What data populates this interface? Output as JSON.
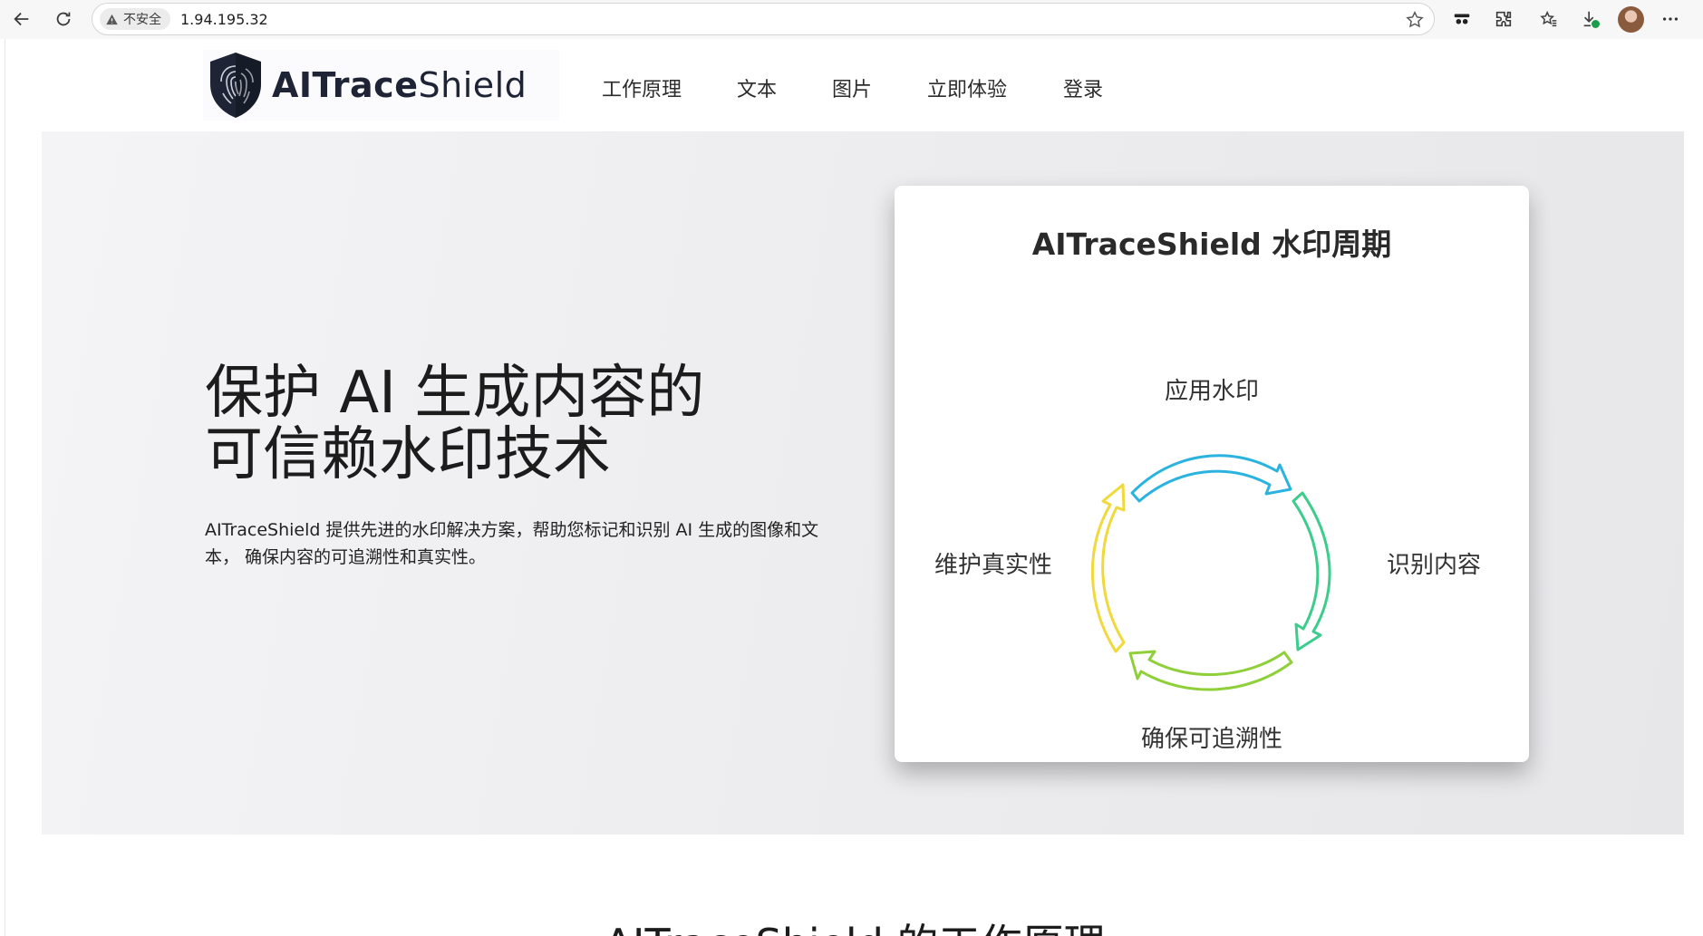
{
  "browser": {
    "security_label": "不安全",
    "url": "1.94.195.32"
  },
  "nav": {
    "logo_bold": "AITrace",
    "logo_light": "Shield",
    "links": [
      "工作原理",
      "文本",
      "图片",
      "立即体验",
      "登录"
    ]
  },
  "hero": {
    "title_line1": "保护 AI 生成内容的",
    "title_line2": "可信赖水印技术",
    "description": "AITraceShield 提供先进的水印解决方案，帮助您标记和识别 AI 生成的图像和文本， 确保内容的可追溯性和真实性。"
  },
  "cycle_card": {
    "title": "AITraceShield 水印周期",
    "steps": {
      "top": "应用水印",
      "right": "识别内容",
      "bottom": "确保可追溯性",
      "left": "维护真实性"
    },
    "colors": {
      "top": "#2bb3e0",
      "right": "#3ccc8c",
      "bottom": "#8fcf3a",
      "left": "#f0d93a"
    }
  },
  "section": {
    "title": "AITraceShield 的工作原理"
  }
}
